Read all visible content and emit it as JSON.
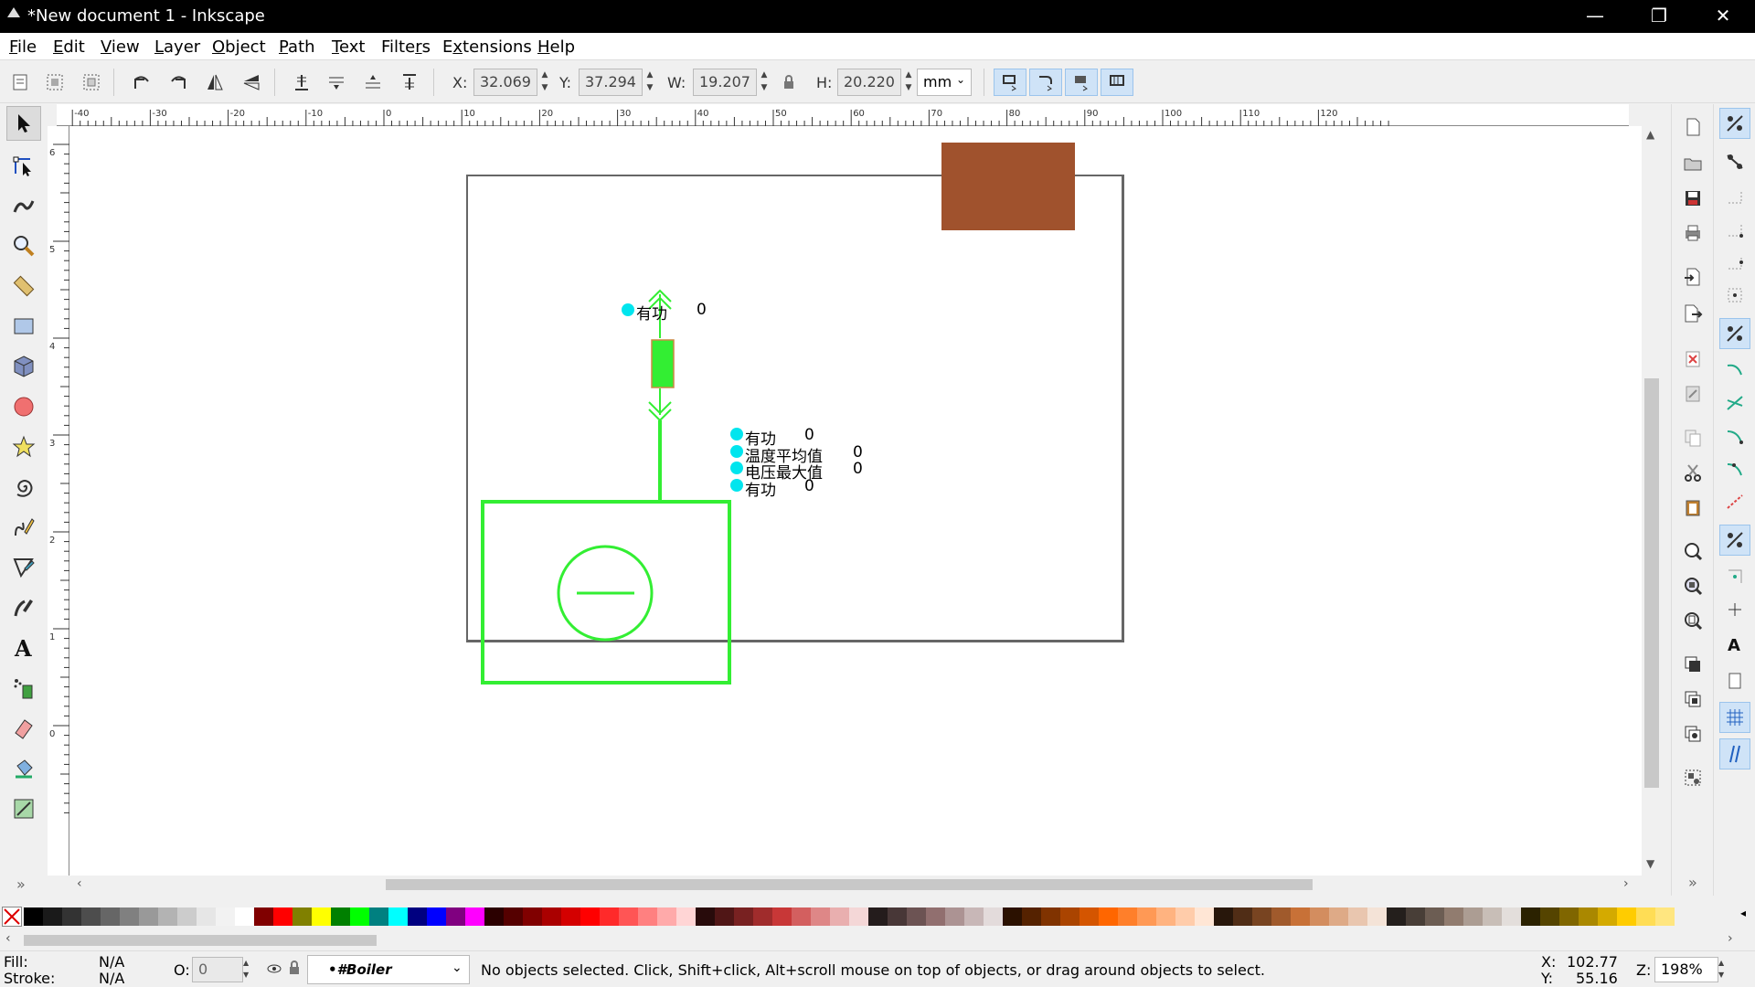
{
  "window": {
    "title": "*New document 1 - Inkscape",
    "minimize": "—",
    "restore": "❐",
    "close": "✕"
  },
  "menu": [
    "File",
    "Edit",
    "View",
    "Layer",
    "Object",
    "Path",
    "Text",
    "Filters",
    "Extensions",
    "Help"
  ],
  "menu_underline": [
    "F",
    "E",
    "V",
    "L",
    "O",
    "P",
    "T",
    "r",
    "x",
    "H"
  ],
  "controls": {
    "x_label": "X:",
    "x_value": "32.069",
    "y_label": "Y:",
    "y_value": "37.294",
    "w_label": "W:",
    "w_value": "19.207",
    "h_label": "H:",
    "h_value": "20.220",
    "unit": "mm"
  },
  "ruler_h_ticks": [
    "-40",
    "-30",
    "-20",
    "-10",
    "0",
    "10",
    "20",
    "30",
    "40",
    "50",
    "60",
    "70",
    "80",
    "90",
    "100",
    "110",
    "120"
  ],
  "ruler_v_ticks": [
    "6",
    "5",
    "4",
    "3",
    "2",
    "1",
    "0"
  ],
  "canvas_text": {
    "top_label": "有功",
    "top_value": "0",
    "row1_label": "有功",
    "row1_value": "0",
    "row2_label": "温度平均值",
    "row2_value": "0",
    "row3_label": "电压最大值",
    "row3_value": "0",
    "row4_label": "有功",
    "row4_value": "0"
  },
  "colors": {
    "accent_green": "#33ee33",
    "brown": "#a0522d",
    "cyan": "#00e5ee",
    "selection_blue": "#cfe3f7"
  },
  "palette": [
    "#000000",
    "#1a1a1a",
    "#333333",
    "#4d4d4d",
    "#666666",
    "#808080",
    "#999999",
    "#b3b3b3",
    "#cccccc",
    "#e6e6e6",
    "#f2f2f2",
    "#ffffff",
    "#800000",
    "#ff0000",
    "#808000",
    "#ffff00",
    "#008000",
    "#00ff00",
    "#008080",
    "#00ffff",
    "#000080",
    "#0000ff",
    "#800080",
    "#ff00ff",
    "#2b0000",
    "#550000",
    "#800000",
    "#aa0000",
    "#d40000",
    "#ff0000",
    "#ff2a2a",
    "#ff5555",
    "#ff8080",
    "#ffaaaa",
    "#ffd5d5",
    "#280b0b",
    "#501616",
    "#782121",
    "#a02c2c",
    "#c83737",
    "#d35f5f",
    "#de8787",
    "#e9afaf",
    "#f4d7d7",
    "#241c1c",
    "#483737",
    "#6c5353",
    "#916f6f",
    "#ac9393",
    "#c8b7b7",
    "#e3dbdb",
    "#2b1100",
    "#552200",
    "#803300",
    "#aa4400",
    "#d45500",
    "#ff6600",
    "#ff7f2a",
    "#ff9955",
    "#ffb380",
    "#ffccaa",
    "#ffe6d5",
    "#28170b",
    "#502d16",
    "#784421",
    "#a05a2c",
    "#c87137",
    "#d38d5f",
    "#deaa87",
    "#e9c6af",
    "#f4e3d7",
    "#241f1c",
    "#483e37",
    "#6c5d53",
    "#917c6f",
    "#ac9d93",
    "#c8beb7",
    "#e3dedb",
    "#2b2200",
    "#554400",
    "#806600",
    "#aa8800",
    "#d4aa00",
    "#ffcc00",
    "#ffdd55",
    "#ffe680"
  ],
  "status": {
    "fill_label": "Fill:",
    "fill_value": "N/A",
    "stroke_label": "Stroke:",
    "stroke_value": "N/A",
    "opacity_label": "O:",
    "opacity_value": "0",
    "layer": "•#Boiler",
    "message": "No objects selected. Click, Shift+click, Alt+scroll mouse on top of objects, or drag around objects to select.",
    "x_label": "X:",
    "x_value": "102.77",
    "y_label": "Y:",
    "y_value": "55.16",
    "zoom_label": "Z:",
    "zoom_value": "198%"
  }
}
